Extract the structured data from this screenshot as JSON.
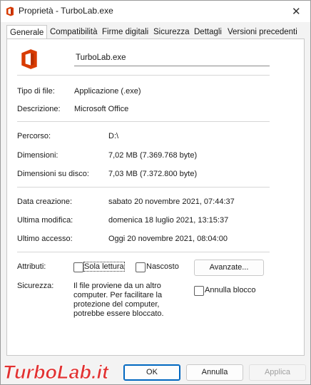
{
  "window": {
    "title": "Proprietà - TurboLab.exe",
    "close_glyph": "✕"
  },
  "tabs": [
    {
      "label": "Generale",
      "active": true
    },
    {
      "label": "Compatibilità"
    },
    {
      "label": "Firme digitali"
    },
    {
      "label": "Sicurezza"
    },
    {
      "label": "Dettagli"
    },
    {
      "label": "Versioni precedenti"
    }
  ],
  "general": {
    "file_name": "TurboLab.exe",
    "tipo_label": "Tipo di file:",
    "tipo_value": "Applicazione (.exe)",
    "descr_label": "Descrizione:",
    "descr_value": "Microsoft Office",
    "percorso_label": "Percorso:",
    "percorso_value": "D:\\",
    "dim_label": "Dimensioni:",
    "dim_value": "7,02 MB (7.369.768 byte)",
    "dimdisco_label": "Dimensioni su disco:",
    "dimdisco_value": "7,03 MB (7.372.800 byte)",
    "creazione_label": "Data creazione:",
    "creazione_value": "sabato 20 novembre 2021, 07:44:37",
    "modifica_label": "Ultima modifica:",
    "modifica_value": "domenica 18 luglio 2021, 13:15:37",
    "accesso_label": "Ultimo accesso:",
    "accesso_value": "Oggi 20 novembre 2021, 08:04:00",
    "attributi_label": "Attributi:",
    "sola_lettura": "Sola lettura",
    "sola_lettura_checked": false,
    "nascosto": "Nascosto",
    "nascosto_checked": false,
    "avanzate": "Avanzate...",
    "sicurezza_label": "Sicurezza:",
    "sicurezza_lines": [
      "Il file proviene da un altro",
      "computer. Per facilitare la",
      "protezione del computer,",
      "potrebbe essere bloccato."
    ],
    "annulla_blocco": "Annulla blocco",
    "annulla_blocco_checked": false
  },
  "footer": {
    "ok": "OK",
    "annulla": "Annulla",
    "applica": "Applica"
  },
  "watermark": {
    "text": "TurboLab.it"
  },
  "colors": {
    "office_red": "#d83b01",
    "accent": "#0067c0",
    "watermark_red": "#e01e1e"
  },
  "icons": {
    "app": "office-icon",
    "close": "close-icon"
  }
}
